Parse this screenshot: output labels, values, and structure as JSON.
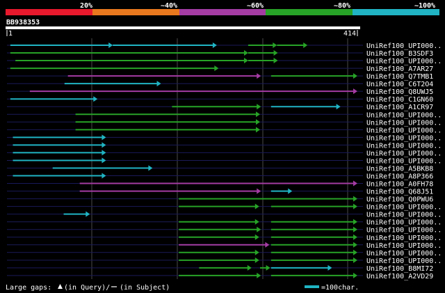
{
  "score_bar": {
    "segments": [
      {
        "color": "#e8192c",
        "label": ""
      },
      {
        "color": "#e8781e",
        "label": "20%"
      },
      {
        "color": "#a43ca4",
        "label": "~40%"
      },
      {
        "color": "#27a327",
        "label": "~60%"
      },
      {
        "color": "#20b4c4",
        "label": "~80%"
      }
    ],
    "end_label": "~100%"
  },
  "query": {
    "accession": "BB938353",
    "start_label": "1",
    "end_label": "414",
    "length": 414
  },
  "hits": [
    {
      "label": "UniRef100_UPI000..",
      "segs": [
        [
          4,
          125,
          "#20b4c4"
        ],
        [
          125,
          248,
          "#20b4c4"
        ],
        [
          285,
          319,
          "#27a327"
        ],
        [
          319,
          355,
          "#27a327"
        ]
      ]
    },
    {
      "label": "UniRef100_B3SDF3",
      "segs": [
        [
          4,
          285,
          "#27a327"
        ],
        [
          285,
          320,
          "#27a327"
        ]
      ]
    },
    {
      "label": "UniRef100_UPI000..",
      "segs": [
        [
          10,
          285,
          "#27a327"
        ],
        [
          285,
          320,
          "#27a327"
        ]
      ]
    },
    {
      "label": "UniRef100_A7AR27",
      "segs": [
        [
          4,
          250,
          "#27a327"
        ]
      ]
    },
    {
      "label": "UniRef100_Q7TMB1",
      "segs": [
        [
          72,
          300,
          "#a43ca4"
        ],
        [
          312,
          414,
          "#27a327"
        ]
      ]
    },
    {
      "label": "UniRef100_C6T2O4",
      "segs": [
        [
          68,
          182,
          "#20b4c4"
        ]
      ]
    },
    {
      "label": "UniRef100_Q8UWJ5",
      "segs": [
        [
          27,
          414,
          "#a43ca4"
        ]
      ]
    },
    {
      "label": "UniRef100_C1GN60",
      "segs": [
        [
          4,
          107,
          "#20b4c4"
        ]
      ]
    },
    {
      "label": "UniRef100_A1CR97",
      "segs": [
        [
          195,
          300,
          "#27a327"
        ],
        [
          312,
          394,
          "#20b4c4"
        ]
      ]
    },
    {
      "label": "UniRef100_UPI000..",
      "segs": [
        [
          81,
          299,
          "#27a327"
        ]
      ]
    },
    {
      "label": "UniRef100_UPI000..",
      "segs": [
        [
          81,
          299,
          "#27a327"
        ]
      ]
    },
    {
      "label": "UniRef100_UPI000..",
      "segs": [
        [
          81,
          299,
          "#27a327"
        ]
      ]
    },
    {
      "label": "UniRef100_UPI000..",
      "segs": [
        [
          7,
          117,
          "#20b4c4"
        ]
      ]
    },
    {
      "label": "UniRef100_UPI000..",
      "segs": [
        [
          7,
          117,
          "#20b4c4"
        ]
      ]
    },
    {
      "label": "UniRef100_UPI000..",
      "segs": [
        [
          7,
          117,
          "#20b4c4"
        ]
      ]
    },
    {
      "label": "UniRef100_UPI000..",
      "segs": [
        [
          7,
          117,
          "#20b4c4"
        ]
      ]
    },
    {
      "label": "UniRef100_A5BKB8",
      "segs": [
        [
          54,
          172,
          "#20b4c4"
        ]
      ]
    },
    {
      "label": "UniRef100_A8P366",
      "segs": [
        [
          7,
          117,
          "#20b4c4"
        ]
      ]
    },
    {
      "label": "UniRef100_A0FH78",
      "segs": [
        [
          86,
          414,
          "#a43ca4"
        ]
      ]
    },
    {
      "label": "UniRef100_Q68J51",
      "segs": [
        [
          86,
          300,
          "#a43ca4"
        ],
        [
          312,
          337,
          "#20b4c4"
        ]
      ]
    },
    {
      "label": "UniRef100_Q0PWU6",
      "segs": [
        [
          203,
          414,
          "#27a327"
        ]
      ]
    },
    {
      "label": "UniRef100_UPI000..",
      "segs": [
        [
          203,
          298,
          "#27a327"
        ],
        [
          312,
          414,
          "#27a327"
        ]
      ]
    },
    {
      "label": "UniRef100_UPI000..",
      "segs": [
        [
          67,
          98,
          "#20b4c4"
        ]
      ]
    },
    {
      "label": "UniRef100_UPI000..",
      "segs": [
        [
          203,
          298,
          "#27a327"
        ],
        [
          312,
          414,
          "#27a327"
        ]
      ]
    },
    {
      "label": "UniRef100_UPI000..",
      "segs": [
        [
          203,
          300,
          "#27a327"
        ],
        [
          312,
          414,
          "#27a327"
        ]
      ]
    },
    {
      "label": "UniRef100_UPI000..",
      "segs": [
        [
          203,
          298,
          "#27a327"
        ],
        [
          312,
          414,
          "#27a327"
        ]
      ]
    },
    {
      "label": "UniRef100_UPI000..",
      "segs": [
        [
          203,
          310,
          "#a43ca4"
        ],
        [
          312,
          414,
          "#27a327"
        ]
      ]
    },
    {
      "label": "UniRef100_UPI000..",
      "segs": [
        [
          203,
          298,
          "#27a327"
        ],
        [
          312,
          414,
          "#27a327"
        ]
      ]
    },
    {
      "label": "UniRef100_UPI000..",
      "segs": [
        [
          203,
          298,
          "#27a327"
        ],
        [
          312,
          414,
          "#27a327"
        ]
      ]
    },
    {
      "label": "UniRef100_B8MI72",
      "segs": [
        [
          227,
          289,
          "#27a327"
        ],
        [
          299,
          311,
          "#27a327"
        ],
        [
          312,
          384,
          "#20b4c4"
        ]
      ]
    },
    {
      "label": "UniRef100_A2VD29",
      "segs": [
        [
          203,
          300,
          "#27a327"
        ],
        [
          312,
          414,
          "#27a327"
        ]
      ]
    }
  ],
  "footer": {
    "gaps_label": "Large gaps:",
    "query_gap": "(in Query)/",
    "subject_gap": "(in Subject)",
    "scale_label": "=100char.",
    "scale_color": "#20b4c4"
  }
}
